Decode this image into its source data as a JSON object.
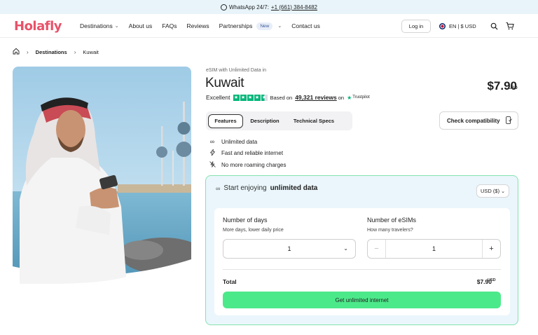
{
  "topbar": {
    "whatsapp_label": "WhatsApp 24/7:",
    "phone": "+1 (661) 384-8482"
  },
  "nav": {
    "logo": "Holafly",
    "items": [
      {
        "label": "Destinations",
        "has_dropdown": true
      },
      {
        "label": "About us",
        "has_dropdown": false
      },
      {
        "label": "FAQs",
        "has_dropdown": false
      },
      {
        "label": "Reviews",
        "has_dropdown": false
      },
      {
        "label": "Partnerships",
        "badge": "New",
        "has_dropdown": true
      },
      {
        "label": "Contact us",
        "has_dropdown": false
      }
    ],
    "login": "Log in",
    "locale": "EN | $ USD",
    "icons": [
      "search-icon",
      "cart-icon"
    ]
  },
  "breadcrumb": {
    "home_icon": "home-icon",
    "items": [
      "Destinations",
      "Kuwait"
    ]
  },
  "product": {
    "eyebrow": "eSIM with Unlimited Data in",
    "title": "Kuwait",
    "price": "$7.90",
    "currency": "USD",
    "rating": {
      "label": "Excellent",
      "stars": 4.5,
      "based_on": "Based on",
      "reviews": "49,321 reviews",
      "on": "on",
      "provider": "Trustpilot"
    }
  },
  "tabs": [
    {
      "label": "Features",
      "active": true
    },
    {
      "label": "Description",
      "active": false
    },
    {
      "label": "Technical Specs",
      "active": false
    }
  ],
  "check_compatibility": "Check compatibility",
  "features": [
    {
      "icon": "infinity-icon",
      "glyph": "∞",
      "label": "Unlimited data"
    },
    {
      "icon": "lightning-icon",
      "glyph": "⚡",
      "label": "Fast and reliable internet"
    },
    {
      "icon": "no-roaming-icon",
      "glyph": "⊘",
      "label": "No more roaming charges"
    }
  ],
  "plan": {
    "heading_prefix": "Start enjoying",
    "heading_bold": "unlimited data",
    "currency_select": "USD ($)",
    "days": {
      "label": "Number of days",
      "sub": "More days, lower daily price",
      "value": "1"
    },
    "esims": {
      "label": "Number of eSIMs",
      "sub": "How many travelers?",
      "value": "1",
      "minus": "−",
      "plus": "+"
    },
    "total_label": "Total",
    "total_value": "$7.90",
    "total_currency": "USD",
    "cta": "Get unlimited internet"
  },
  "colors": {
    "brand": "#e8536a",
    "cta": "#4ce98a",
    "trustpilot": "#00b67a",
    "plan_bg": "#eaf6fb",
    "plan_border": "#86e2b2"
  }
}
